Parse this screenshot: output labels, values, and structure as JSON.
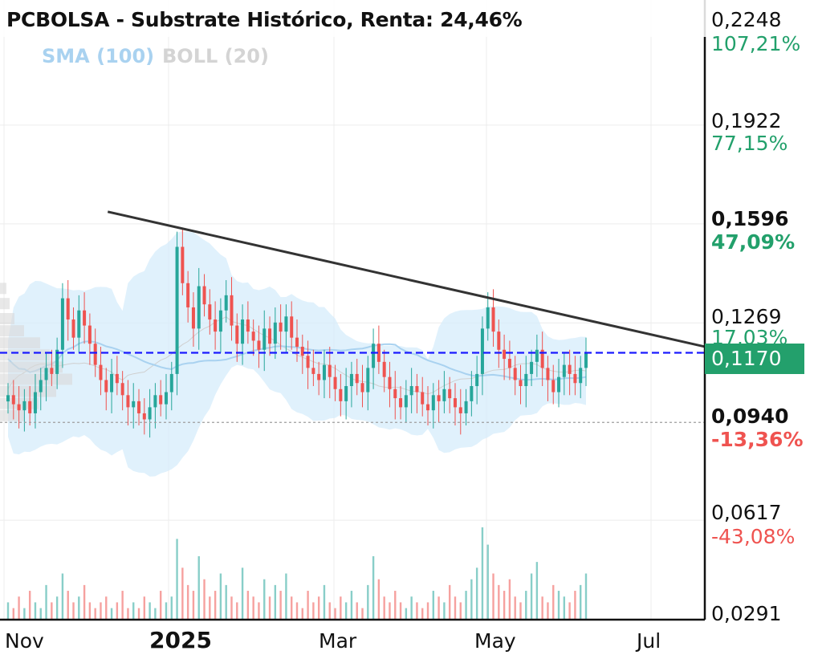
{
  "header": {
    "title": "PCBOLSA - Substrate Histórico, Renta: 24,46%",
    "sma_label": "SMA (100)",
    "boll_label": "BOLL (20)"
  },
  "y_axis": {
    "labels": [
      {
        "price": "0,2248",
        "pct": "107,21%"
      },
      {
        "price": "0,1922",
        "pct": "77,15%"
      },
      {
        "price": "0,1596",
        "pct": "47,09%"
      },
      {
        "price": "0,1269",
        "pct": "17,03%"
      },
      {
        "price": "0,0940",
        "pct": "-13,36%"
      },
      {
        "price": "0,0617",
        "pct": "-43,08%"
      },
      {
        "price": "0,0291"
      }
    ],
    "current_price": "0,1170"
  },
  "x_axis": {
    "labels": [
      "Nov",
      "2025",
      "Mar",
      "May",
      "Jul"
    ]
  },
  "colors": {
    "up": "#26a69a",
    "down": "#ef5350",
    "band": "#d6ecfb",
    "sma": "#a9d2f0",
    "trendline": "#333333",
    "current_line": "#1a1aff",
    "badge": "#23a06c"
  },
  "chart_data": {
    "type": "candlestick",
    "title": "PCBOLSA - Substrate Histórico, Renta: 24,46%",
    "y_range": [
      0.0291,
      0.2248
    ],
    "x_ticks": [
      "Nov",
      "2025",
      "Mar",
      "May",
      "Jul"
    ],
    "reference_price": 0.094,
    "current_price": 0.117,
    "trendline": [
      {
        "date": "2024-12-06",
        "price": 0.1636
      },
      {
        "date": "2025-07-27",
        "price": 0.118
      }
    ],
    "sma_period": 100,
    "boll_period": 20,
    "grid": true,
    "candles_close": [
      0.103,
      0.1,
      0.098,
      0.101,
      0.097,
      0.104,
      0.108,
      0.112,
      0.11,
      0.118,
      0.135,
      0.128,
      0.122,
      0.131,
      0.126,
      0.12,
      0.113,
      0.108,
      0.104,
      0.11,
      0.107,
      0.103,
      0.099,
      0.101,
      0.097,
      0.095,
      0.099,
      0.103,
      0.1,
      0.104,
      0.11,
      0.152,
      0.14,
      0.132,
      0.125,
      0.139,
      0.133,
      0.128,
      0.124,
      0.131,
      0.136,
      0.126,
      0.12,
      0.128,
      0.124,
      0.121,
      0.118,
      0.125,
      0.12,
      0.127,
      0.124,
      0.129,
      0.122,
      0.119,
      0.116,
      0.112,
      0.11,
      0.108,
      0.113,
      0.109,
      0.105,
      0.101,
      0.106,
      0.11,
      0.107,
      0.104,
      0.112,
      0.12,
      0.114,
      0.109,
      0.105,
      0.102,
      0.099,
      0.103,
      0.106,
      0.104,
      0.1,
      0.098,
      0.103,
      0.101,
      0.105,
      0.102,
      0.099,
      0.097,
      0.101,
      0.106,
      0.11,
      0.125,
      0.132,
      0.124,
      0.118,
      0.115,
      0.112,
      0.108,
      0.106,
      0.11,
      0.114,
      0.118,
      0.112,
      0.108,
      0.104,
      0.109,
      0.113,
      0.11,
      0.107,
      0.112,
      0.117
    ],
    "volume": [
      3,
      2,
      4,
      2,
      5,
      3,
      2,
      6,
      3,
      4,
      8,
      5,
      3,
      4,
      6,
      3,
      2,
      3,
      4,
      2,
      3,
      5,
      2,
      3,
      2,
      4,
      3,
      2,
      5,
      3,
      4,
      14,
      9,
      6,
      5,
      11,
      7,
      4,
      5,
      8,
      6,
      4,
      3,
      9,
      5,
      4,
      3,
      7,
      4,
      6,
      5,
      8,
      4,
      3,
      2,
      5,
      3,
      4,
      6,
      3,
      2,
      4,
      3,
      5,
      3,
      2,
      6,
      11,
      7,
      4,
      3,
      5,
      3,
      2,
      4,
      3,
      2,
      3,
      5,
      4,
      3,
      6,
      4,
      3,
      5,
      7,
      9,
      16,
      13,
      8,
      6,
      5,
      7,
      4,
      3,
      5,
      8,
      10,
      4,
      3,
      6,
      5,
      4,
      3,
      5,
      6,
      8
    ]
  }
}
